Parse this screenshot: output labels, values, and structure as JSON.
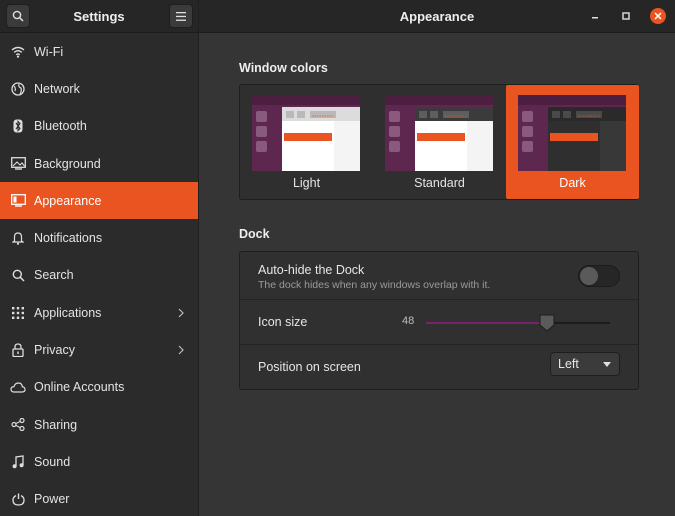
{
  "header": {
    "app_title": "Settings",
    "page_title": "Appearance",
    "search_icon": "search-icon",
    "menu_icon": "hamburger-icon",
    "window_controls": [
      "minimize-icon",
      "maximize-icon",
      "close-icon"
    ]
  },
  "sidebar": {
    "items": [
      {
        "label": "Wi-Fi",
        "icon": "wifi-icon"
      },
      {
        "label": "Network",
        "icon": "network-icon"
      },
      {
        "label": "Bluetooth",
        "icon": "bluetooth-icon"
      },
      {
        "label": "Background",
        "icon": "background-icon"
      },
      {
        "label": "Appearance",
        "icon": "appearance-icon",
        "active": true
      },
      {
        "label": "Notifications",
        "icon": "bell-icon"
      },
      {
        "label": "Search",
        "icon": "search-icon"
      },
      {
        "label": "Applications",
        "icon": "grid-icon",
        "submenu": true
      },
      {
        "label": "Privacy",
        "icon": "lock-icon",
        "submenu": true
      },
      {
        "label": "Online Accounts",
        "icon": "cloud-icon"
      },
      {
        "label": "Sharing",
        "icon": "share-icon"
      },
      {
        "label": "Sound",
        "icon": "music-note-icon"
      },
      {
        "label": "Power",
        "icon": "power-icon"
      }
    ]
  },
  "window_colors": {
    "title": "Window colors",
    "themes": [
      {
        "label": "Light"
      },
      {
        "label": "Standard"
      },
      {
        "label": "Dark",
        "selected": true
      }
    ]
  },
  "dock": {
    "title": "Dock",
    "autohide": {
      "label": "Auto-hide the Dock",
      "description": "The dock hides when any windows overlap with it.",
      "enabled": false
    },
    "icon_size": {
      "label": "Icon size",
      "value": "48",
      "fraction": 0.66
    },
    "position": {
      "label": "Position on screen",
      "value": "Left"
    }
  },
  "colors": {
    "accent": "#e95420",
    "aubergine": "#77216f",
    "thumb_sidebar": "#5e2750"
  }
}
